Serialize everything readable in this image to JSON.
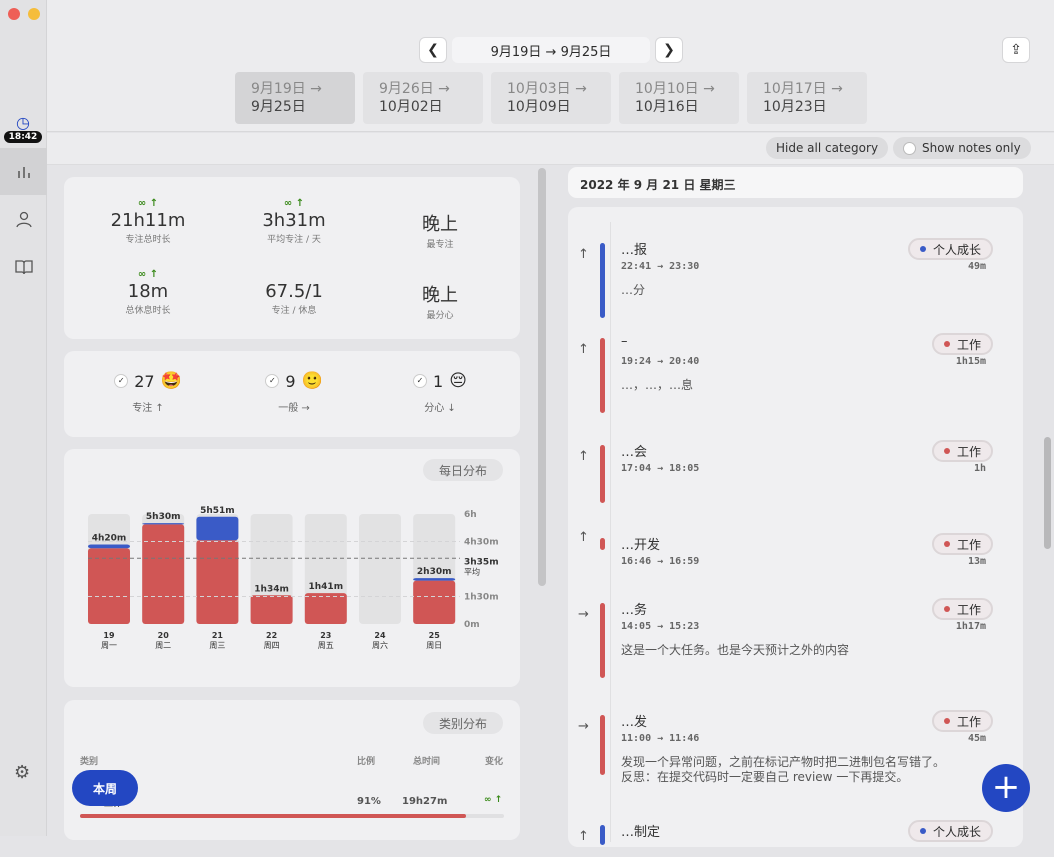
{
  "colors": {
    "work": "#d05655",
    "personal": "#3a5bc7",
    "accent": "#2347c2",
    "trend": "#3a8a1a"
  },
  "sidebar": {
    "clock_time": "18:42",
    "items": [
      {
        "icon": "bar-chart-icon"
      },
      {
        "icon": "person-icon"
      },
      {
        "icon": "book-icon"
      }
    ],
    "settings_icon": "gear-icon"
  },
  "header": {
    "range": "9月19日 → 9月25日",
    "weeks": [
      {
        "a": "9月19日 →",
        "b": "9月25日"
      },
      {
        "a": "9月26日 →",
        "b": "10月02日"
      },
      {
        "a": "10月03日 →",
        "b": "10月09日"
      },
      {
        "a": "10月10日 →",
        "b": "10月16日"
      },
      {
        "a": "10月17日 →",
        "b": "10月23日"
      }
    ]
  },
  "toolbar": {
    "hide_all": "Hide all category",
    "notes_only": "Show notes only"
  },
  "stats": [
    {
      "trend": "∞ ↑",
      "value": "21h11m",
      "label": "专注总时长"
    },
    {
      "trend": "∞ ↑",
      "value": "3h31m",
      "label": "平均专注 / 天"
    },
    {
      "trend": "",
      "value": "晚上",
      "label": "最专注"
    },
    {
      "trend": "∞ ↑",
      "value": "18m",
      "label": "总休息时长"
    },
    {
      "trend": "",
      "value": "67.5/1",
      "label": "专注 / 休息"
    },
    {
      "trend": "",
      "value": "晚上",
      "label": "最分心"
    }
  ],
  "moods": [
    {
      "count": "27",
      "emoji": "🤩",
      "label": "专注 ↑"
    },
    {
      "count": "9",
      "emoji": "🙂",
      "label": "一般 →"
    },
    {
      "count": "1",
      "emoji": "😔",
      "label": "分心 ↓"
    }
  ],
  "chart_data": {
    "type": "bar",
    "stacked": true,
    "title": "每日分布",
    "categories": [
      "19",
      "20",
      "21",
      "22",
      "23",
      "24",
      "25"
    ],
    "weekdays": [
      "周一",
      "周二",
      "周三",
      "周四",
      "周五",
      "周六",
      "周日"
    ],
    "totals": [
      "4h20m",
      "5h30m",
      "5h51m",
      "1h34m",
      "1h41m",
      "",
      "2h30m"
    ],
    "series": [
      {
        "color": "#d05655",
        "values": [
          248,
          326,
          274,
          94,
          101,
          0,
          142
        ]
      },
      {
        "color": "#3a5bc7",
        "values": [
          12,
          4,
          77,
          0,
          0,
          0,
          8
        ]
      }
    ],
    "ylim": [
      0,
      360
    ],
    "yticks": [
      {
        "v": 360,
        "label": "6h"
      },
      {
        "v": 270,
        "label": "4h30m"
      },
      {
        "v": 90,
        "label": "1h30m"
      },
      {
        "v": 0,
        "label": "0m"
      }
    ],
    "average": {
      "v": 215,
      "label": "3h35m",
      "sub": "平均"
    },
    "grid": true
  },
  "category": {
    "title": "类别分布",
    "headers": [
      "类别",
      "比例",
      "总时间",
      "变化"
    ],
    "rows": [
      {
        "name": "工作",
        "ratio": "91%",
        "total": "19h27m",
        "change": "∞ ↑",
        "fill": 0.91
      }
    ]
  },
  "this_week": "本周",
  "day": {
    "title": "2022 年 9 月 21 日 星期三",
    "entries": [
      {
        "arrow": "↑",
        "title": "…报",
        "time": "22:41 → 23:30",
        "tag": "个人成长",
        "cat": "personal",
        "dur": "49m",
        "note": "…分"
      },
      {
        "arrow": "↑",
        "title": "–",
        "time": "19:24 → 20:40",
        "tag": "工作",
        "cat": "work",
        "dur": "1h15m",
        "note": "…，…，…息"
      },
      {
        "arrow": "↑",
        "title": "…会",
        "time": "17:04 → 18:05",
        "tag": "工作",
        "cat": "work",
        "dur": "1h",
        "note": ""
      },
      {
        "arrow": "↑",
        "title": "…开发",
        "time": "16:46 → 16:59",
        "tag": "工作",
        "cat": "work",
        "dur": "13m",
        "note": ""
      },
      {
        "arrow": "→",
        "title": "…务",
        "time": "14:05 → 15:23",
        "tag": "工作",
        "cat": "work",
        "dur": "1h17m",
        "note": "这是一个大任务。也是今天预计之外的内容"
      },
      {
        "arrow": "→",
        "title": "…发",
        "time": "11:00 → 11:46",
        "tag": "工作",
        "cat": "work",
        "dur": "45m",
        "note": "发现一个异常问题，之前在标记产物时把二进制包名写错了。\n反思：在提交代码时一定要自己 review 一下再提交。"
      },
      {
        "arrow": "↑",
        "title": "…制定",
        "time": "",
        "tag": "个人成长",
        "cat": "personal",
        "dur": "",
        "note": ""
      }
    ]
  }
}
